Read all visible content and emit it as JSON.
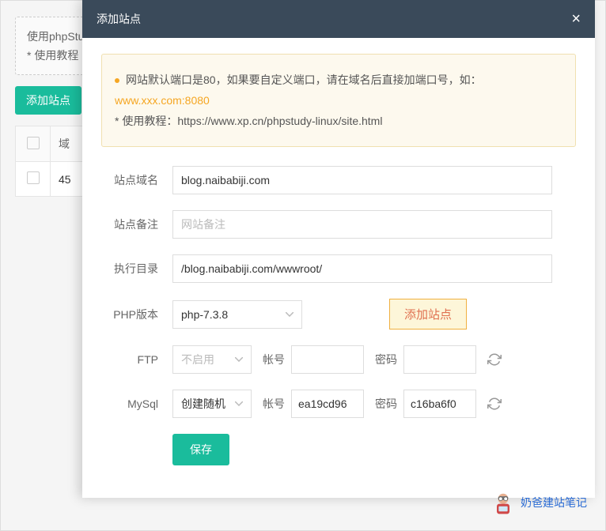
{
  "background": {
    "tip1": "使用phpStu",
    "tip2": "* 使用教程",
    "add_button": "添加站点",
    "table_header_domain": "域",
    "table_cell": "45"
  },
  "modal": {
    "title": "添加站点",
    "close": "×"
  },
  "tips": {
    "line1": "网站默认端口是80，如果要自定义端口，请在域名后直接加端口号，如：",
    "line2": "www.xxx.com:8080",
    "line3_prefix": "* 使用教程：",
    "line3_url": "https://www.xp.cn/phpstudy-linux/site.html"
  },
  "form": {
    "domain_label": "站点域名",
    "domain_value": "blog.naibabiji.com",
    "remark_label": "站点备注",
    "remark_placeholder": "网站备注",
    "dir_label": "执行目录",
    "dir_value": "/blog.naibabiji.com/wwwroot/",
    "php_label": "PHP版本",
    "php_value": "php-7.3.8",
    "add_site_button": "添加站点",
    "ftp_label": "FTP",
    "ftp_value": "不启用",
    "mysql_label": "MySql",
    "mysql_value": "创建随机",
    "account_label": "帐号",
    "password_label": "密码",
    "mysql_account": "ea19cd96",
    "mysql_password": "c16ba6f0",
    "save_button": "保存"
  },
  "watermark": "奶爸建站笔记"
}
